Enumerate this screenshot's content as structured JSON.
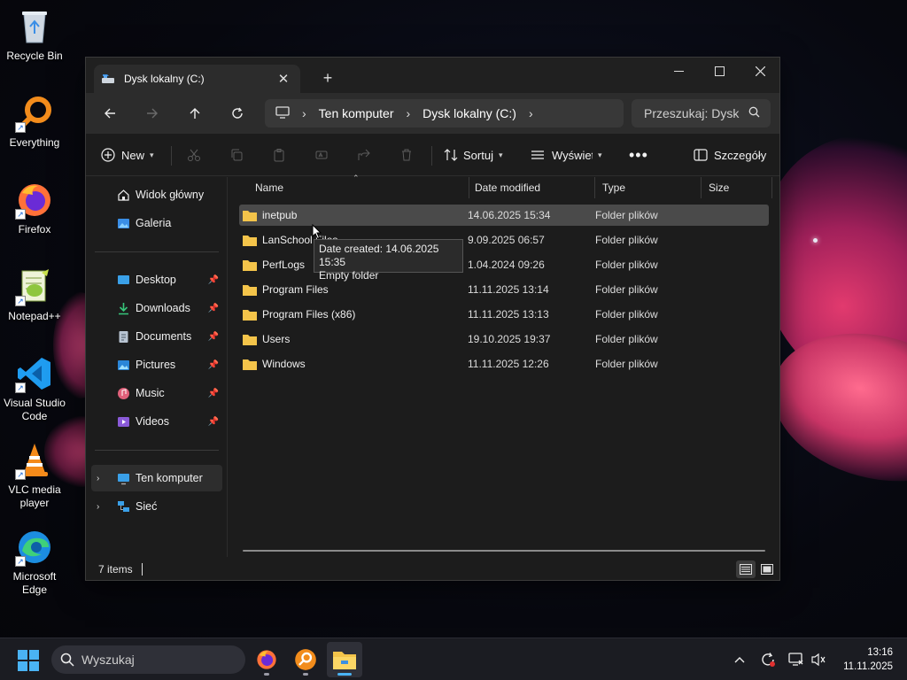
{
  "desktop": {
    "icons": [
      {
        "label": "Recycle Bin"
      },
      {
        "label": "Everything"
      },
      {
        "label": "Firefox"
      },
      {
        "label": "Notepad++"
      },
      {
        "label": "Visual Studio Code"
      },
      {
        "label": "VLC media player"
      },
      {
        "label": "Microsoft Edge"
      }
    ]
  },
  "window": {
    "tab_title": "Dysk lokalny (C:)",
    "address": {
      "crumbs": [
        "Ten komputer",
        "Dysk lokalny (C:)"
      ]
    },
    "search": {
      "placeholder": "Przeszukaj: Dysk"
    },
    "commands": {
      "new_label": "New",
      "sort_label": "Sortuj",
      "view_label": "Wyświetl",
      "details_label": "Szczegóły"
    },
    "nav": {
      "home": "Widok główny",
      "gallery": "Galeria",
      "desktop": "Desktop",
      "downloads": "Downloads",
      "documents": "Documents",
      "pictures": "Pictures",
      "music": "Music",
      "videos": "Videos",
      "this_pc": "Ten komputer",
      "network": "Sieć"
    },
    "columns": {
      "name": "Name",
      "date": "Date modified",
      "type": "Type",
      "size": "Size"
    },
    "rows": [
      {
        "name": "inetpub",
        "date": "14.06.2025 15:34",
        "type": "Folder plików"
      },
      {
        "name": "LanSchool Files",
        "date": "9.09.2025 06:57",
        "type": "Folder plików"
      },
      {
        "name": "PerfLogs",
        "date": "1.04.2024 09:26",
        "type": "Folder plików"
      },
      {
        "name": "Program Files",
        "date": "11.11.2025 13:14",
        "type": "Folder plików"
      },
      {
        "name": "Program Files (x86)",
        "date": "11.11.2025 13:13",
        "type": "Folder plików"
      },
      {
        "name": "Users",
        "date": "19.10.2025 19:37",
        "type": "Folder plików"
      },
      {
        "name": "Windows",
        "date": "11.11.2025 12:26",
        "type": "Folder plików"
      }
    ],
    "tooltip": {
      "line1": "Date created: 14.06.2025 15:35",
      "line2": "Empty folder"
    },
    "status": {
      "items": "7 items"
    }
  },
  "taskbar": {
    "search_placeholder": "Wyszukaj",
    "clock": {
      "time": "13:16",
      "date": "11.11.2025"
    }
  },
  "colors": {
    "folder": "#f4c44a",
    "accent": "#3b8fe0",
    "window_bg": "#1c1c1c"
  }
}
